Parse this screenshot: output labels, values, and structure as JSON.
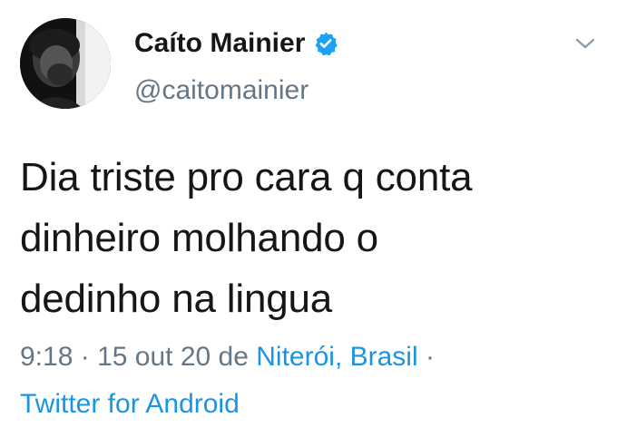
{
  "tweet": {
    "display_name": "Caíto Mainier",
    "handle": "@caitomainier",
    "verified": true,
    "text_lines": [
      "Dia triste pro cara q conta",
      "dinheiro molhando o",
      "dedinho na lingua"
    ],
    "time": "9:18",
    "separator": "·",
    "date": "15 out 20",
    "location_prefix": "de",
    "location": "Niterói, Brasil",
    "source": "Twitter for Android"
  },
  "icons": {
    "verified": "verified-badge-icon",
    "caret": "chevron-down-icon",
    "avatar": "profile-photo"
  },
  "colors": {
    "name": "#14171a",
    "secondary": "#657786",
    "link": "#1b95e0",
    "verified": "#1da1f2"
  }
}
